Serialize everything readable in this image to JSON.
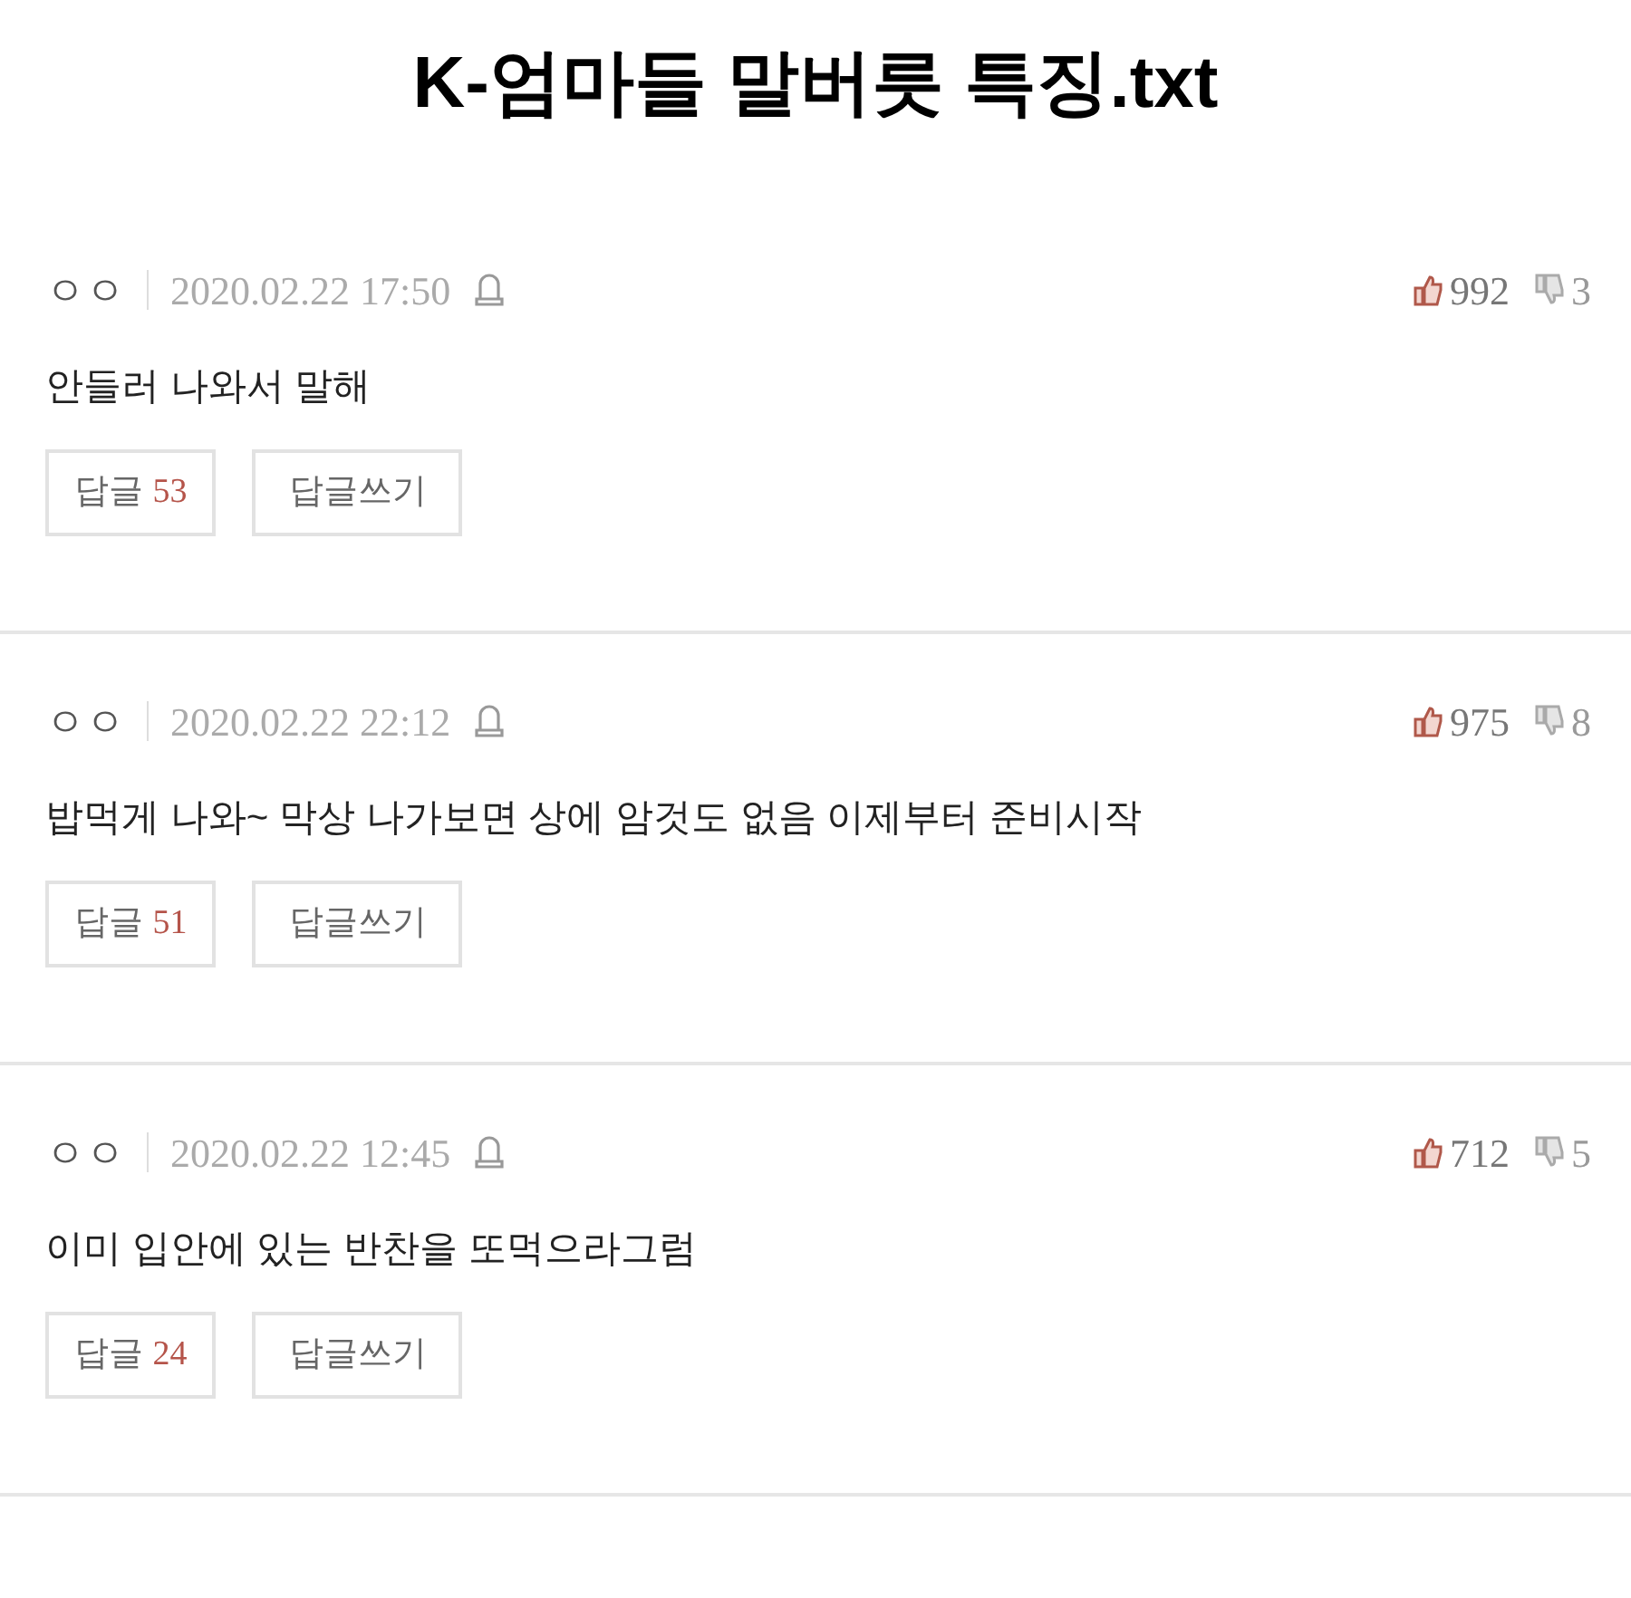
{
  "title": "K-엄마들 말버릇 특징.txt",
  "comments": [
    {
      "author": "ㅇㅇ",
      "date": "2020.02.22 17:50",
      "likes": "992",
      "dislikes": "3",
      "text": "안들러 나와서 말해",
      "reply_label": "답글",
      "reply_count": "53",
      "write_label": "답글쓰기"
    },
    {
      "author": "ㅇㅇ",
      "date": "2020.02.22 22:12",
      "likes": "975",
      "dislikes": "8",
      "text": "밥먹게 나와~ 막상 나가보면 상에 암것도 없음 이제부터 준비시작",
      "reply_label": "답글",
      "reply_count": "51",
      "write_label": "답글쓰기"
    },
    {
      "author": "ㅇㅇ",
      "date": "2020.02.22 12:45",
      "likes": "712",
      "dislikes": "5",
      "text": "이미 입안에 있는 반찬을 또먹으라그럼",
      "reply_label": "답글",
      "reply_count": "24",
      "write_label": "답글쓰기"
    }
  ]
}
